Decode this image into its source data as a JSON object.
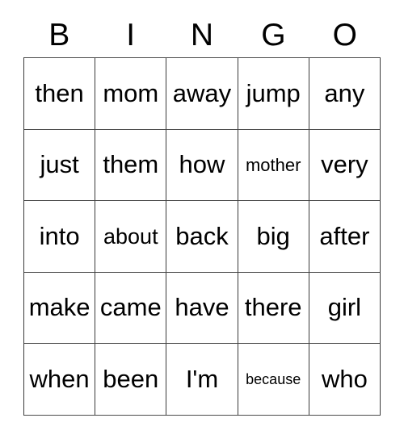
{
  "card": {
    "title": "BINGO word card",
    "background_color": "#ffffff",
    "text_color": "#000000",
    "border_color": "#3a3a3a"
  },
  "header": {
    "letters": [
      "B",
      "I",
      "N",
      "G",
      "O"
    ]
  },
  "grid": {
    "columns": 5,
    "rows": 5,
    "cells": [
      {
        "text": "then",
        "size": "lg"
      },
      {
        "text": "mom",
        "size": "lg"
      },
      {
        "text": "away",
        "size": "lg"
      },
      {
        "text": "jump",
        "size": "lg"
      },
      {
        "text": "any",
        "size": "lg"
      },
      {
        "text": "just",
        "size": "lg"
      },
      {
        "text": "them",
        "size": "lg"
      },
      {
        "text": "how",
        "size": "lg"
      },
      {
        "text": "mother",
        "size": "sm"
      },
      {
        "text": "very",
        "size": "lg"
      },
      {
        "text": "into",
        "size": "lg"
      },
      {
        "text": "about",
        "size": "md"
      },
      {
        "text": "back",
        "size": "lg"
      },
      {
        "text": "big",
        "size": "lg"
      },
      {
        "text": "after",
        "size": "lg"
      },
      {
        "text": "make",
        "size": "lg"
      },
      {
        "text": "came",
        "size": "lg"
      },
      {
        "text": "have",
        "size": "lg"
      },
      {
        "text": "there",
        "size": "lg"
      },
      {
        "text": "girl",
        "size": "lg"
      },
      {
        "text": "when",
        "size": "lg"
      },
      {
        "text": "been",
        "size": "lg"
      },
      {
        "text": "I'm",
        "size": "lg"
      },
      {
        "text": "because",
        "size": "xs"
      },
      {
        "text": "who",
        "size": "lg"
      }
    ]
  }
}
